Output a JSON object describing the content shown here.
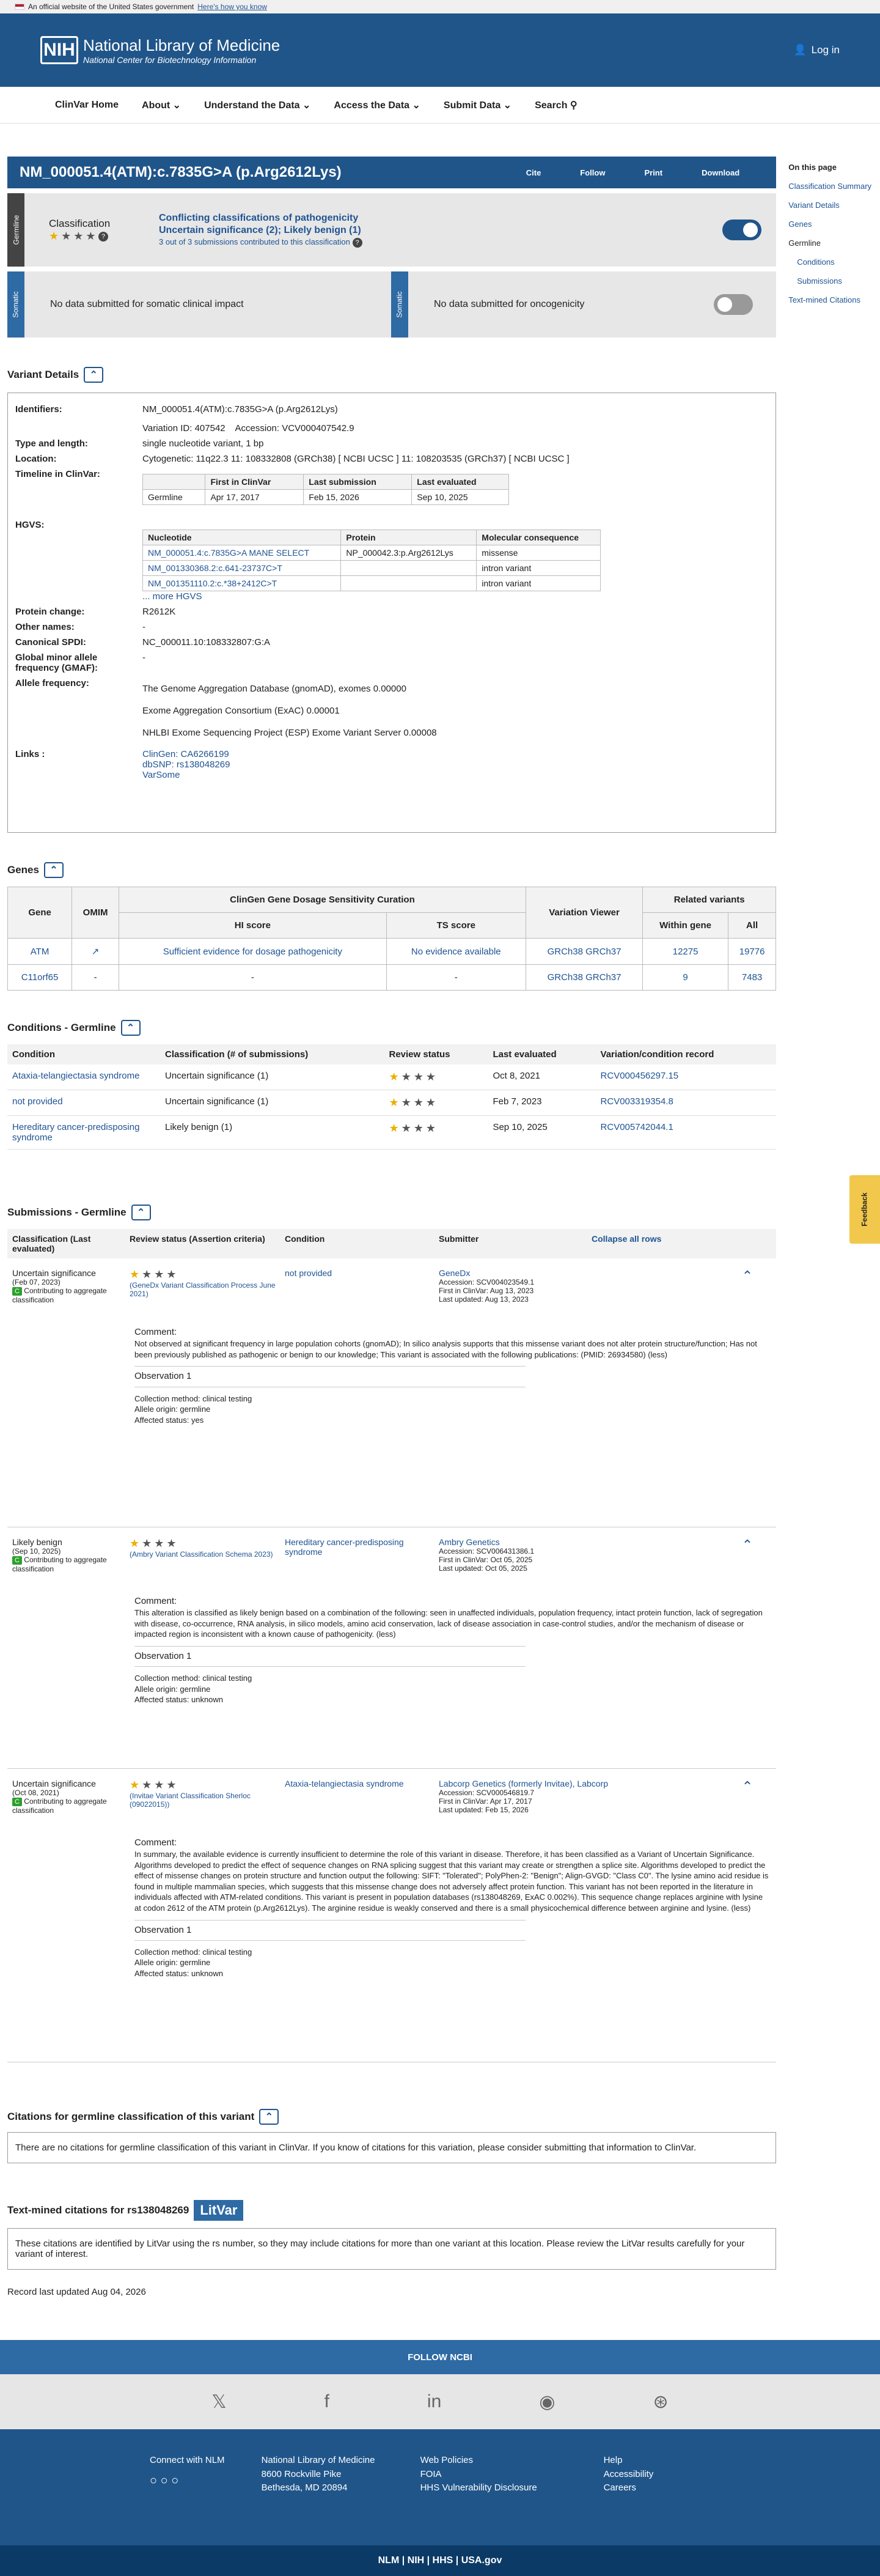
{
  "gov": {
    "text": "An official website of the United States government",
    "how": "Here's how you know"
  },
  "header": {
    "logo": "NIH",
    "title": "National Library of Medicine",
    "subtitle": "National Center for Biotechnology Information",
    "login": "Log in"
  },
  "nav": [
    "ClinVar Home",
    "About ⌄",
    "Understand the Data ⌄",
    "Access the Data ⌄",
    "Submit Data ⌄",
    "Search"
  ],
  "title": "NM_000051.4(ATM):c.7835G>A (p.Arg2612Lys)",
  "actions": [
    "Cite",
    "Follow",
    "Print",
    "Download"
  ],
  "germline": {
    "tab": "Germline",
    "label": "Classification",
    "c1": "Conflicting classifications of pathogenicity",
    "c2": "Uncertain significance (2); Likely benign (1)",
    "c3": "3 out of 3 submissions contributed to this classification"
  },
  "somatic": {
    "tab": "Somatic",
    "impact": "No data submitted for somatic clinical impact",
    "onco": "No data submitted for oncogenicity"
  },
  "sections": {
    "variant": "Variant Details",
    "genes": "Genes",
    "conditions": "Conditions - Germline",
    "submissions": "Submissions - Germline",
    "citations": "Citations for germline classification of this variant",
    "textmined": "Text-mined citations for rs138048269"
  },
  "vd": {
    "identifiers": "NM_000051.4(ATM):c.7835G>A (p.Arg2612Lys)",
    "vid": "Variation ID: 407542",
    "acc": "Accession: VCV000407542.9",
    "type": "single nucleotide variant, 1 bp",
    "location": "Cytogenetic: 11q22.3    11: 108332808 (GRCh38) [ NCBI  UCSC ]    11: 108203535 (GRCh37) [ NCBI  UCSC ]",
    "timeline_head": [
      "",
      "First in ClinVar",
      "Last submission",
      "Last evaluated"
    ],
    "timeline_row": [
      "Germline",
      "Apr 17, 2017",
      "Feb 15, 2026",
      "Sep 10, 2025"
    ],
    "hgvs_head": [
      "Nucleotide",
      "Protein",
      "Molecular consequence"
    ],
    "hgvs": [
      [
        "NM_000051.4:c.7835G>A  MANE SELECT",
        "NP_000042.3:p.Arg2612Lys",
        "missense"
      ],
      [
        "NM_001330368.2:c.641-23737C>T",
        "",
        "intron variant"
      ],
      [
        "NM_001351110.2:c.*38+2412C>T",
        "",
        "intron variant"
      ]
    ],
    "more": "... more HGVS",
    "protein": "R2612K",
    "other": "-",
    "spdi": "NC_000011.10:108332807:G:A",
    "gmaf": "-",
    "freq": [
      "The Genome Aggregation Database (gnomAD), exomes 0.00000",
      "Exome Aggregation Consortium (ExAC) 0.00001",
      "NHLBI Exome Sequencing Project (ESP) Exome Variant Server 0.00008"
    ],
    "links": [
      "ClinGen: CA6266199",
      "dbSNP: rs138048269",
      "VarSome"
    ],
    "labels": [
      "Identifiers:",
      "Type and length:",
      "Location:",
      "Timeline in ClinVar:",
      "HGVS:",
      "Protein change:",
      "Other names:",
      "Canonical SPDI:",
      "Global minor allele frequency (GMAF):",
      "Allele frequency:",
      "Links :"
    ]
  },
  "genes": {
    "head": [
      "Gene",
      "OMIM",
      "HI score",
      "TS score",
      "Variation Viewer",
      "Within gene",
      "All"
    ],
    "group1": "ClinGen Gene Dosage Sensitivity Curation",
    "group2": "Related variants",
    "rows": [
      [
        "ATM",
        "↗",
        "Sufficient evidence for dosage pathogenicity",
        "No evidence available",
        "GRCh38 GRCh37",
        "12275",
        "19776"
      ],
      [
        "C11orf65",
        "-",
        "-",
        "-",
        "GRCh38 GRCh37",
        "9",
        "7483"
      ]
    ]
  },
  "conds": {
    "head": [
      "Condition",
      "Classification (# of submissions)",
      "Review status",
      "Last evaluated",
      "Variation/condition record"
    ],
    "rows": [
      [
        "Ataxia-telangiectasia syndrome",
        "Uncertain significance (1)",
        "Oct 8, 2021",
        "RCV000456297.15"
      ],
      [
        "not provided",
        "Uncertain significance (1)",
        "Feb 7, 2023",
        "RCV003319354.8"
      ],
      [
        "Hereditary cancer-predisposing syndrome",
        "Likely benign (1)",
        "Sep 10, 2025",
        "RCV005742044.1"
      ]
    ]
  },
  "subs": {
    "head": [
      "Classification (Last evaluated)",
      "Review status (Assertion criteria)",
      "Condition",
      "Submitter",
      "Collapse all rows"
    ],
    "items": [
      {
        "cls": "Uncertain significance",
        "date": "(Feb 07, 2023)",
        "crit": "(GeneDx Variant Classification Process June 2021)",
        "cond": "not provided",
        "sub": "GeneDx",
        "acc": "Accession: SCV004023549.1",
        "first": "First in ClinVar: Aug 13, 2023",
        "last": "Last updated: Aug 13, 2023",
        "comment": "Not observed at significant frequency in large population cohorts (gnomAD); In silico analysis supports that this missense variant does not alter protein structure/function; Has not been previously published as pathogenic or benign to our knowledge; This variant is associated with the following publications: (PMID: 26934580) (less)",
        "obs": [
          "Collection method: clinical testing",
          "Allele origin: germline",
          "Affected status: yes"
        ]
      },
      {
        "cls": "Likely benign",
        "date": "(Sep 10, 2025)",
        "crit": "(Ambry Variant Classification Schema 2023)",
        "cond": "Hereditary cancer-predisposing syndrome",
        "sub": "Ambry Genetics",
        "acc": "Accession: SCV006431386.1",
        "first": "First in ClinVar: Oct 05, 2025",
        "last": "Last updated: Oct 05, 2025",
        "comment": "This alteration is classified as likely benign based on a combination of the following: seen in unaffected individuals, population frequency, intact protein function, lack of segregation with disease, co-occurrence, RNA analysis, in silico models, amino acid conservation, lack of disease association in case-control studies, and/or the mechanism of disease or impacted region is inconsistent with a known cause of pathogenicity. (less)",
        "obs": [
          "Collection method: clinical testing",
          "Allele origin: germline",
          "Affected status: unknown"
        ]
      },
      {
        "cls": "Uncertain significance",
        "date": "(Oct 08, 2021)",
        "crit": "(Invitae Variant Classification Sherloc (09022015))",
        "cond": "Ataxia-telangiectasia syndrome",
        "sub": "Labcorp Genetics (formerly Invitae), Labcorp",
        "acc": "Accession: SCV000546819.7",
        "first": "First in ClinVar: Apr 17, 2017",
        "last": "Last updated: Feb 15, 2026",
        "comment": "In summary, the available evidence is currently insufficient to determine the role of this variant in disease. Therefore, it has been classified as a Variant of Uncertain Significance. Algorithms developed to predict the effect of sequence changes on RNA splicing suggest that this variant may create or strengthen a splice site. Algorithms developed to predict the effect of missense changes on protein structure and function output the following: SIFT: \"Tolerated\"; PolyPhen-2: \"Benign\"; Align-GVGD: \"Class C0\". The lysine amino acid residue is found in multiple mammalian species, which suggests that this missense change does not adversely affect protein function. This variant has not been reported in the literature in individuals affected with ATM-related conditions. This variant is present in population databases (rs138048269, ExAC 0.002%). This sequence change replaces arginine with lysine at codon 2612 of the ATM protein (p.Arg2612Lys). The arginine residue is weakly conserved and there is a small physicochemical difference between arginine and lysine. (less)",
        "obs": [
          "Collection method: clinical testing",
          "Allele origin: germline",
          "Affected status: unknown"
        ]
      }
    ],
    "contrib": "Contributing to aggregate classification",
    "comment": "Comment:",
    "obs_title": "Observation 1"
  },
  "cit_msg": "There are no citations for germline classification of this variant in ClinVar. If you know of citations for this variation, please consider submitting that information to ClinVar.",
  "litvar": "LitVar",
  "tm_msg": "These citations are identified by LitVar using the rs number, so they may include citations for more than one variant at this location. Please review the LitVar results carefully for your variant of interest.",
  "updated": "Record last updated Aug 04, 2026",
  "follow": "FOLLOW NCBI",
  "footer": {
    "col1": [
      "Connect with NLM"
    ],
    "col2": [
      "National Library of Medicine",
      "8600 Rockville Pike",
      "Bethesda, MD 20894"
    ],
    "col3": [
      "Web Policies",
      "FOIA",
      "HHS Vulnerability Disclosure"
    ],
    "col4": [
      "Help",
      "Accessibility",
      "Careers"
    ]
  },
  "bottom": "NLM | NIH | HHS | USA.gov",
  "side": [
    "On this page",
    "Classification Summary",
    "Variant Details",
    "Genes",
    "Germline",
    "Conditions",
    "Submissions",
    "Text-mined Citations"
  ],
  "feedback": "Feedback"
}
